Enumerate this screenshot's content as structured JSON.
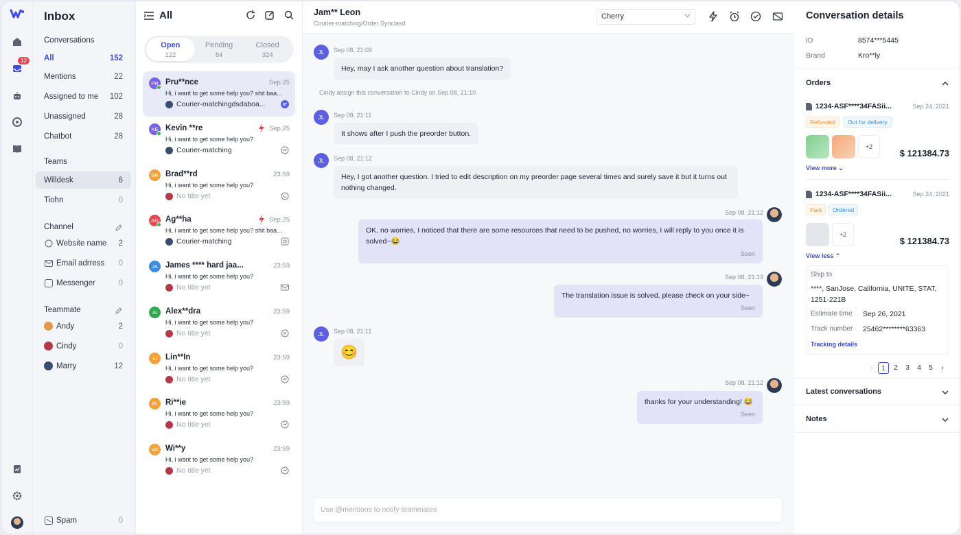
{
  "rail": {
    "badge_count": "12"
  },
  "nav": {
    "title": "Inbox",
    "conversations_heading": "Conversations",
    "items": [
      {
        "label": "All",
        "count": "152"
      },
      {
        "label": "Mentions",
        "count": "22"
      },
      {
        "label": "Assigned to me",
        "count": "102"
      },
      {
        "label": "Unassigned",
        "count": "28"
      },
      {
        "label": "Chatbot",
        "count": "28"
      }
    ],
    "teams_heading": "Teams",
    "teams": [
      {
        "label": "Willdesk",
        "count": "6"
      },
      {
        "label": "Tiohn",
        "count": "0"
      }
    ],
    "channel_heading": "Channel",
    "channels": [
      {
        "label": "Website name",
        "count": "2"
      },
      {
        "label": "Email adrress",
        "count": "0"
      },
      {
        "label": "Messenger",
        "count": "0"
      }
    ],
    "teammate_heading": "Teammate",
    "teammates": [
      {
        "label": "Andy",
        "count": "2"
      },
      {
        "label": "Cindy",
        "count": "0"
      },
      {
        "label": "Marry",
        "count": "12"
      }
    ],
    "spam": {
      "label": "Spam",
      "count": "0"
    }
  },
  "list": {
    "title": "All",
    "tabs": [
      {
        "label": "Open",
        "count": "122"
      },
      {
        "label": "Pending",
        "count": "84"
      },
      {
        "label": "Closed",
        "count": "324"
      }
    ],
    "conversations": [
      {
        "initials": "PR",
        "name": "Pru**nce",
        "time": "Sep,25",
        "message": "Hi, i want to get some help you? shit baa...",
        "sub": "Courier-matchingdsdaboa..."
      },
      {
        "initials": "KE",
        "name": "Kevin **re",
        "time": "Sep,25",
        "message": "Hi, i want to get some help you?",
        "sub": "Courier-matching"
      },
      {
        "initials": "BR",
        "name": "Brad**rd",
        "time": "23:59",
        "message": "Hi, i want to get some help you?",
        "sub": "No title yet"
      },
      {
        "initials": "AG",
        "name": "Ag**ha",
        "time": "Sep,25",
        "message": "Hi, i want to get some help you? shit baa...",
        "sub": "Courier-matching"
      },
      {
        "initials": "JA",
        "name": "James **** hard jaa...",
        "time": "23:59",
        "message": "Hi, i want to get some help you?",
        "sub": "No title yet"
      },
      {
        "initials": "AI",
        "name": "Alex**dra",
        "time": "23:59",
        "message": "Hi, i want to get some help you?",
        "sub": "No title yet"
      },
      {
        "initials": "LI",
        "name": "Lin**In",
        "time": "23:59",
        "message": "Hi, i want to get some help you?",
        "sub": "No title yet"
      },
      {
        "initials": "RI",
        "name": "Ri**ie",
        "time": "23:59",
        "message": "Hi, i want to get some help you?",
        "sub": "No title yet"
      },
      {
        "initials": "WI",
        "name": "Wi**y",
        "time": "23:59",
        "message": "Hi, i want to get some help you?",
        "sub": "No title yet"
      }
    ],
    "colors": {
      "accent": "#3d4cdb",
      "orange": "#f4a13a",
      "green": "#2fa84f",
      "blue": "#3b8be0",
      "purple": "#7b61e8"
    }
  },
  "chat": {
    "title": "Jam** Leon",
    "subtitle": "Courier-matching/Order Synclasd",
    "assignee": "Cherry",
    "system_note": "Cindy assign this conversation to Cindy on Sep 08, 21:10",
    "messages": [
      {
        "initials": "JL",
        "time": "Sep 08, 21:09",
        "text": "Hey, may I ask another question about translation?"
      },
      {
        "initials": "JL",
        "time": "Sep 08, 21:11",
        "text": "It shows after I push the preorder button."
      },
      {
        "initials": "JL",
        "time": "Sep 08, 21:12",
        "text": "Hey, I got another question. I tried to edit description on my preorder page several times and surely save it but it turns out nothing changed."
      },
      {
        "time": "Sep 08, 21:12",
        "text": "OK, no worries, I noticed that there are some resources that need to be pushed, no worries, I will reply to you once it is solved~😂",
        "status": "Seen"
      },
      {
        "time": "Sep 08, 21:13",
        "text": "The translation issue is solved, please check on your side~",
        "status": "Seen"
      },
      {
        "initials": "JL",
        "time": "Sep 08, 21:11",
        "text": "😊"
      },
      {
        "time": "Sep 08, 21:12",
        "text": "thanks for your understanding! 😂",
        "status": "Seen"
      }
    ],
    "compose_placeholder": "Use @mentions to notify teammates"
  },
  "details": {
    "title": "Conversation details",
    "id_label": "ID",
    "id_value": "8574***5445",
    "brand_label": "Brand",
    "brand_value": "Kro**ly",
    "orders_heading": "Orders",
    "orders": [
      {
        "number": "1234-ASF****34FASii...",
        "date": "Sep 24, 2021",
        "tags": [
          "Refunded",
          "Out for delivery"
        ],
        "more": "+2",
        "price": "$ 121384.73",
        "toggle": "View more"
      },
      {
        "number": "1234-ASF****34FASii...",
        "date": "Sep 24, 2021",
        "tags": [
          "Paid",
          "Ordered"
        ],
        "more": "+2",
        "price": "$ 121384.73",
        "toggle": "View less"
      }
    ],
    "ship": {
      "ship_to_label": "Ship to",
      "address": "****, SanJose, California, UNITE, STAT, 1251-221B",
      "estimate_label": "Estimate time",
      "estimate_value": "Sep 26, 2021",
      "track_label": "Track number",
      "track_value": "25462********63363",
      "tracking_link": "Tracking details"
    },
    "pages": [
      "1",
      "2",
      "3",
      "4",
      "5"
    ],
    "latest_heading": "Latest conversations",
    "notes_heading": "Notes"
  }
}
